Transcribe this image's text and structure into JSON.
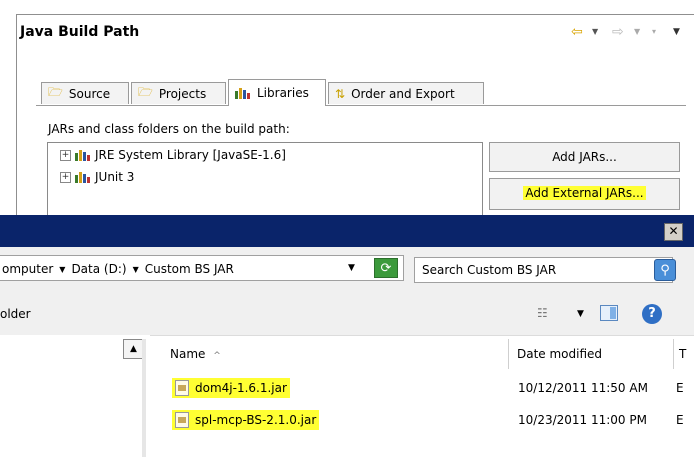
{
  "build_path": {
    "title": "Java Build Path",
    "tabs": [
      {
        "label": "Source",
        "icon": "source-folder-icon"
      },
      {
        "label": "Projects",
        "icon": "projects-folder-icon"
      },
      {
        "label": "Libraries",
        "icon": "libraries-icon"
      },
      {
        "label": "Order and Export",
        "icon": "order-export-icon"
      }
    ],
    "active_tab": "Libraries",
    "jars_label": "JARs and class folders on the build path:",
    "tree": [
      {
        "label": "JRE System Library [JavaSE-1.6]",
        "icon": "library-icon"
      },
      {
        "label": "JUnit 3",
        "icon": "library-icon"
      }
    ],
    "buttons": {
      "add_jars": "Add JARs...",
      "add_external_jars": "Add External JARs..."
    },
    "highlight_color": "#ffff33"
  },
  "dialog": {
    "close_glyph": "✕",
    "breadcrumb": [
      "omputer",
      "Data (D:)",
      "Custom BS JAR"
    ],
    "search_placeholder": "Search Custom BS JAR",
    "toolbar_left": "older",
    "columns": {
      "name": "Name",
      "date_modified": "Date modified",
      "type_truncated": "T"
    },
    "files": [
      {
        "name": "dom4j-1.6.1.jar",
        "date": "10/12/2011 11:50 AM",
        "type": "E"
      },
      {
        "name": "spl-mcp-BS-2.1.0.jar",
        "date": "10/23/2011 11:00 PM",
        "type": "E"
      }
    ],
    "titlebar_color": "#0a246a"
  }
}
